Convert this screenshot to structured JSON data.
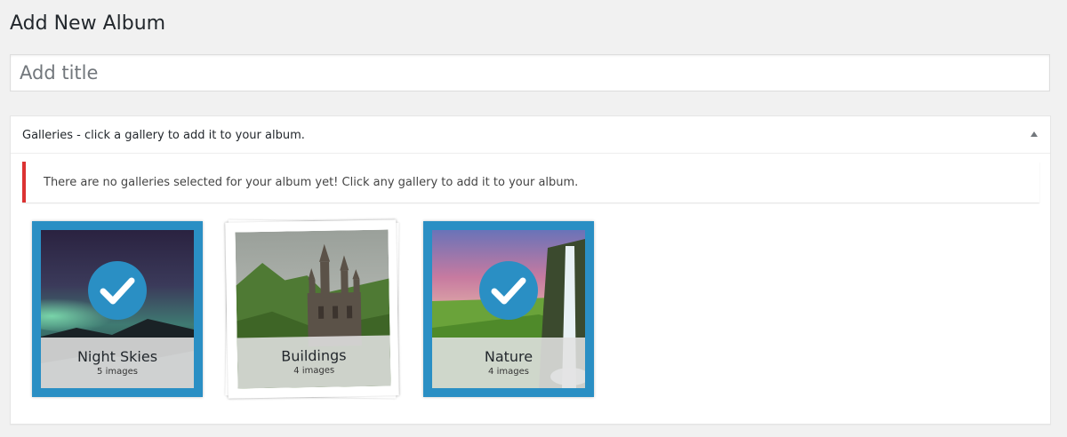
{
  "page": {
    "title": "Add New Album"
  },
  "title_field": {
    "placeholder": "Add title",
    "value": ""
  },
  "galleries_box": {
    "title": "Galleries - click a gallery to add it to your album.",
    "notice": "There are no galleries selected for your album yet! Click any gallery to add it to your album.",
    "items": [
      {
        "name": "Night Skies",
        "count": "5 images",
        "selected": true
      },
      {
        "name": "Buildings",
        "count": "4 images",
        "selected": false
      },
      {
        "name": "Nature",
        "count": "4 images",
        "selected": true
      }
    ]
  },
  "colors": {
    "accent": "#2a8fc4",
    "notice_border": "#dc3232"
  }
}
